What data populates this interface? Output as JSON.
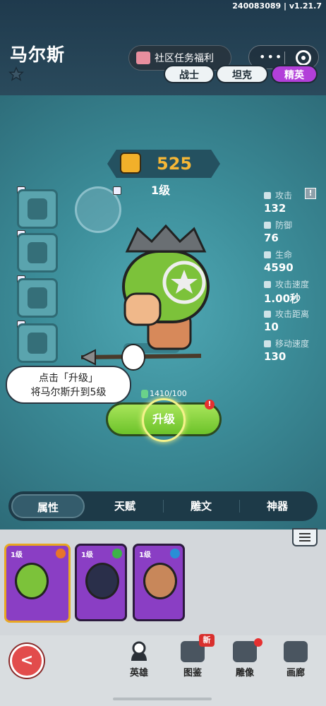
{
  "version": "240083089 | v1.21.7",
  "hero": {
    "name": "马尔斯",
    "power": "525",
    "level": "1级",
    "exp": "1410/100",
    "upgrade_label": "升级",
    "upgrade_badge": "!"
  },
  "header": {
    "community_label": "社区任务福利",
    "capsule_dots": "•••",
    "class_tabs": [
      "战士",
      "坦克",
      "精英"
    ],
    "selected_class": "精英"
  },
  "stats": [
    {
      "label": "攻击",
      "value": "132",
      "icon": "sword-icon"
    },
    {
      "label": "防御",
      "value": "76",
      "icon": "shield-icon"
    },
    {
      "label": "生命",
      "value": "4590",
      "icon": "heart-icon"
    },
    {
      "label": "攻击速度",
      "value": "1.00秒",
      "icon": "attack-speed-icon"
    },
    {
      "label": "攻击距离",
      "value": "10",
      "icon": "range-icon"
    },
    {
      "label": "移动速度",
      "value": "130",
      "icon": "boot-speed-icon"
    }
  ],
  "info_label": "!",
  "tooltip": {
    "line1": "点击「升级」",
    "line2": "将马尔斯升到5级"
  },
  "bottom_tabs": [
    "属性",
    "天赋",
    "雕文",
    "神器"
  ],
  "selected_bottom_tab": "属性",
  "roster": [
    {
      "level": "1级",
      "badge_color": "#e8742a"
    },
    {
      "level": "1级",
      "badge_color": "#3db24a"
    },
    {
      "level": "1级",
      "badge_color": "#2a8fd6"
    }
  ],
  "nav": {
    "back": "<",
    "items": [
      "英雄",
      "图鉴",
      "雕像",
      "画廊"
    ],
    "new_badge": "新"
  },
  "colors": {
    "accent_elite": "#b23fd9",
    "power_gold": "#f6b736",
    "upgrade_green": "#8fd444"
  }
}
